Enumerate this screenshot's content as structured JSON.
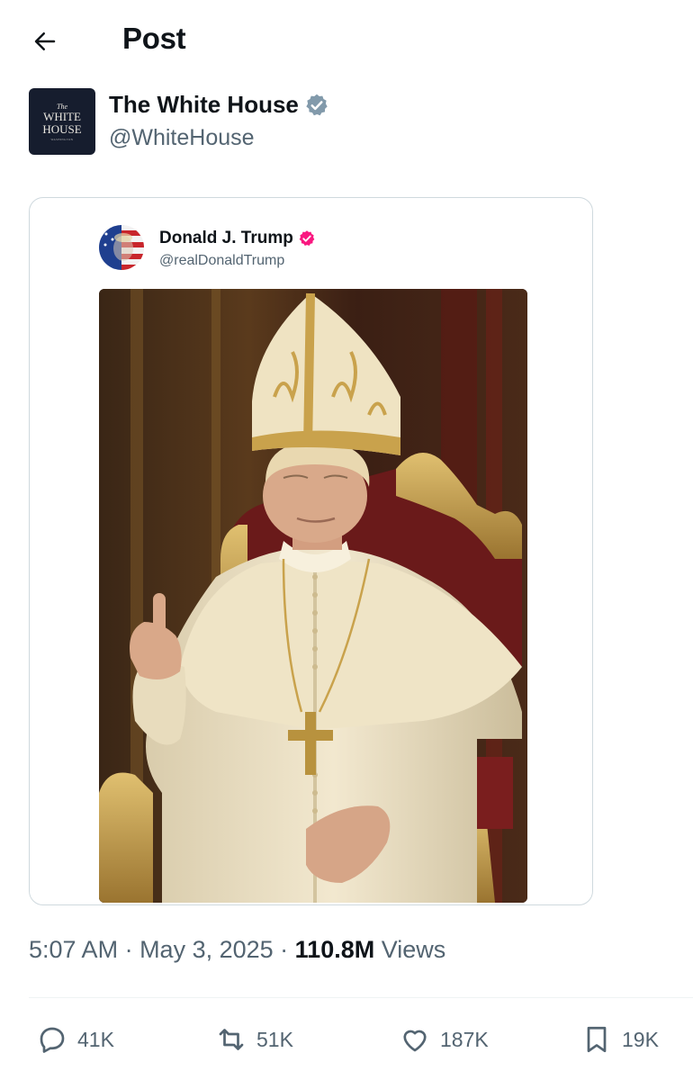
{
  "header": {
    "title": "Post"
  },
  "author": {
    "name": "The White House",
    "handle": "@WhiteHouse",
    "avatar_lines": [
      "The",
      "WHITE",
      "HOUSE",
      "WASHINGTON"
    ]
  },
  "quoted_post": {
    "name": "Donald J. Trump",
    "handle": "@realDonaldTrump",
    "verified_color": "#f91880"
  },
  "meta": {
    "time": "5:07 AM",
    "sep1": " · ",
    "date": "May 3, 2025",
    "sep2": " · ",
    "views_count": "110.8M",
    "views_label": " Views"
  },
  "actions": {
    "replies": "41K",
    "reposts": "51K",
    "likes": "187K",
    "bookmarks": "19K"
  },
  "colors": {
    "text": "#0f1419",
    "muted": "#536471",
    "verified_gray": "#829aab",
    "border": "#cfd9de"
  }
}
